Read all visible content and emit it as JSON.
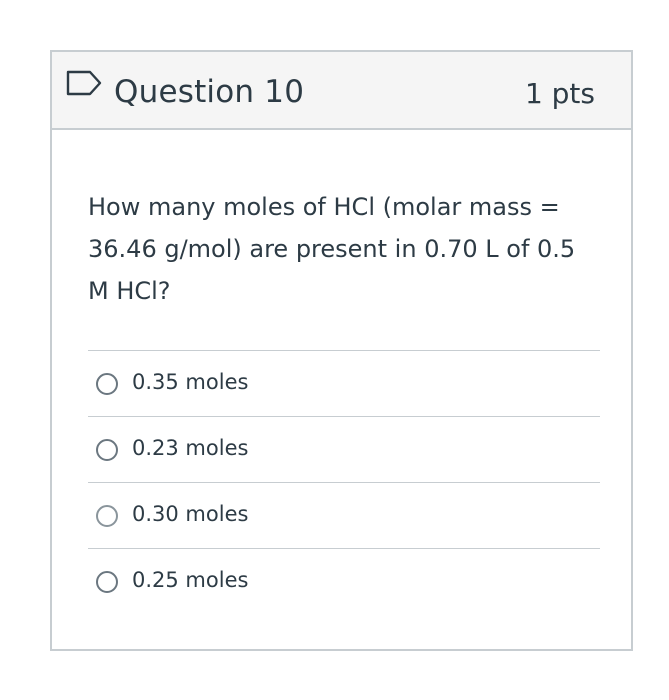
{
  "question": {
    "title": "Question 10",
    "points": "1 pts",
    "flag_icon": "flag-outline-icon",
    "text": "How many moles of HCl (molar mass = 36.46 g/mol) are present in 0.70 L of 0.5 M HCl?"
  },
  "answers": [
    {
      "label": "0.35 moles"
    },
    {
      "label": "0.23 moles"
    },
    {
      "label": "0.30 moles"
    },
    {
      "label": "0.25 moles"
    }
  ],
  "colors": {
    "border": "#c7cdd1",
    "header_bg": "#f5f5f5",
    "text": "#2d3b45",
    "flag": "#2d3b45"
  }
}
